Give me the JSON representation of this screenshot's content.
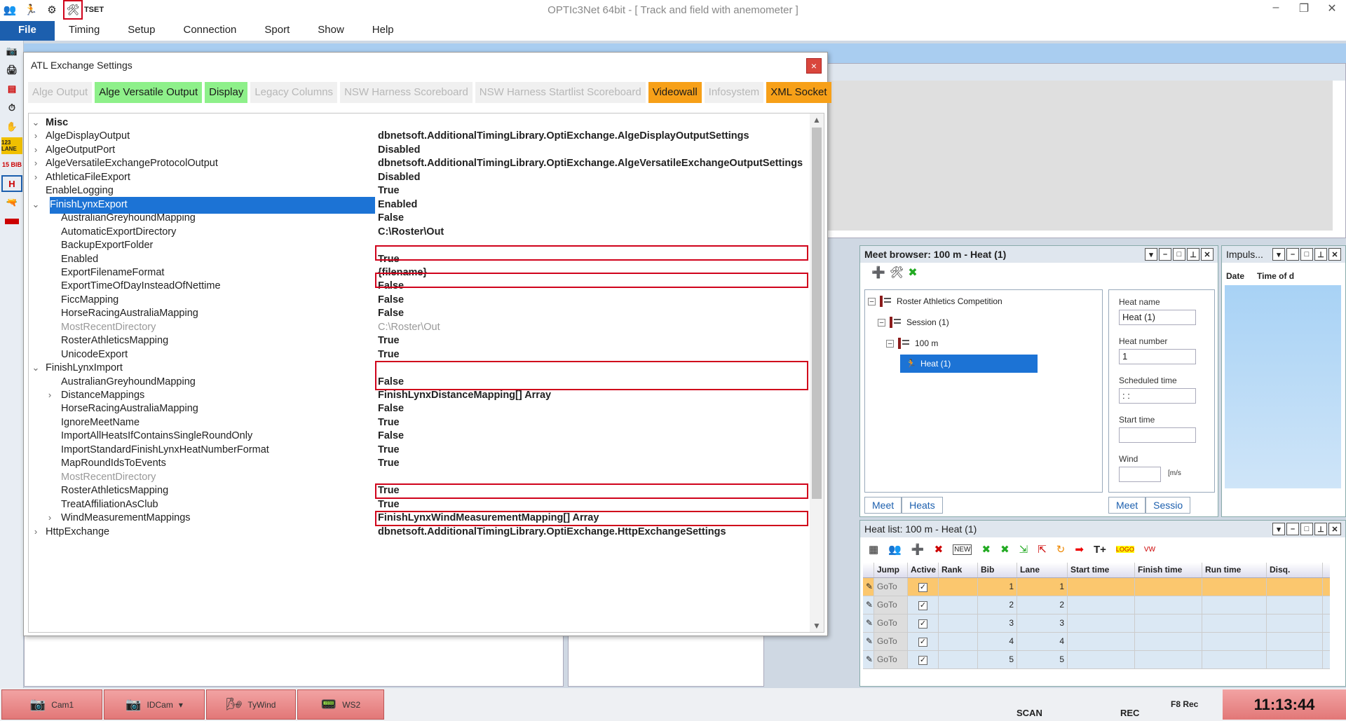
{
  "app": {
    "title": "OPTIc3Net 64bit - [ Track and field with anemometer ]",
    "quick_icons": [
      "users-icon",
      "runner-icon",
      "gear-icon",
      "tools-icon",
      "tset-icon"
    ],
    "tset_label": "TSET"
  },
  "menu": [
    "File",
    "Timing",
    "Setup",
    "Connection",
    "Sport",
    "Show",
    "Help"
  ],
  "left_toolbar": [
    "camera-icon",
    "printer-icon",
    "pdf-icon",
    "stopwatch-icon",
    "hand-icon",
    "lane-icon",
    "bib-icon",
    "h-icon",
    "gun-icon",
    "red-bar-icon"
  ],
  "left_toolbar_labels": {
    "lane": "123 LANE",
    "bib": "15 BIB",
    "h": "H"
  },
  "dialog": {
    "title": "ATL Exchange Settings",
    "close": "×",
    "tabs": [
      {
        "label": "Alge Output",
        "state": "disabled"
      },
      {
        "label": "Alge Versatile Output",
        "state": "green"
      },
      {
        "label": "Display",
        "state": "green"
      },
      {
        "label": "Legacy Columns",
        "state": "disabled"
      },
      {
        "label": "NSW Harness Scoreboard",
        "state": "disabled"
      },
      {
        "label": "NSW Harness Startlist Scoreboard",
        "state": "disabled"
      },
      {
        "label": "Videowall",
        "state": "orange"
      },
      {
        "label": "Infosystem",
        "state": "disabled"
      },
      {
        "label": "XML Socket",
        "state": "orange"
      }
    ],
    "rows": [
      {
        "name": "Misc",
        "value": "",
        "level": 0,
        "exp": "v",
        "kind": "cat"
      },
      {
        "name": "AlgeDisplayOutput",
        "value": "dbnetsoft.AdditionalTimingLibrary.OptiExchange.AlgeDisplayOutputSettings",
        "level": 1,
        "exp": ">"
      },
      {
        "name": "AlgeOutputPort",
        "value": "Disabled",
        "level": 1,
        "exp": ">"
      },
      {
        "name": "AlgeVersatileExchangeProtocolOutput",
        "value": "dbnetsoft.AdditionalTimingLibrary.OptiExchange.AlgeVersatileExchangeOutputSettings",
        "level": 1,
        "exp": ">"
      },
      {
        "name": "AthleticaFileExport",
        "value": "Disabled",
        "level": 1,
        "exp": ">"
      },
      {
        "name": "EnableLogging",
        "value": "True",
        "level": 1,
        "exp": ""
      },
      {
        "name": "FinishLynxExport",
        "value": "Enabled",
        "level": 1,
        "exp": "v",
        "kind": "selected"
      },
      {
        "name": "AustralianGreyhoundMapping",
        "value": "False",
        "level": 2,
        "exp": ""
      },
      {
        "name": "AutomaticExportDirectory",
        "value": "C:\\Roster\\Out",
        "level": 2,
        "exp": ""
      },
      {
        "name": "BackupExportFolder",
        "value": "",
        "level": 2,
        "exp": ""
      },
      {
        "name": "Enabled",
        "value": "True",
        "level": 2,
        "exp": ""
      },
      {
        "name": "ExportFilenameFormat",
        "value": "{filename}",
        "level": 2,
        "exp": ""
      },
      {
        "name": "ExportTimeOfDayInsteadOfNettime",
        "value": "False",
        "level": 2,
        "exp": ""
      },
      {
        "name": "FiccMapping",
        "value": "False",
        "level": 2,
        "exp": ""
      },
      {
        "name": "HorseRacingAustraliaMapping",
        "value": "False",
        "level": 2,
        "exp": ""
      },
      {
        "name": "MostRecentDirectory",
        "value": "C:\\Roster\\Out",
        "level": 2,
        "exp": "",
        "kind": "ro"
      },
      {
        "name": "RosterAthleticsMapping",
        "value": "True",
        "level": 2,
        "exp": ""
      },
      {
        "name": "UnicodeExport",
        "value": "True",
        "level": 2,
        "exp": ""
      },
      {
        "name": "FinishLynxImport",
        "value": "",
        "level": 1,
        "exp": "v"
      },
      {
        "name": "AustralianGreyhoundMapping",
        "value": "False",
        "level": 2,
        "exp": ""
      },
      {
        "name": "DistanceMappings",
        "value": "FinishLynxDistanceMapping[] Array",
        "level": 2,
        "exp": ">"
      },
      {
        "name": "HorseRacingAustraliaMapping",
        "value": "False",
        "level": 2,
        "exp": ""
      },
      {
        "name": "IgnoreMeetName",
        "value": "True",
        "level": 2,
        "exp": ""
      },
      {
        "name": "ImportAllHeatsIfContainsSingleRoundOnly",
        "value": "False",
        "level": 2,
        "exp": ""
      },
      {
        "name": "ImportStandardFinishLynxHeatNumberFormat",
        "value": "True",
        "level": 2,
        "exp": ""
      },
      {
        "name": "MapRoundIdsToEvents",
        "value": "True",
        "level": 2,
        "exp": ""
      },
      {
        "name": "MostRecentDirectory",
        "value": "",
        "level": 2,
        "exp": "",
        "kind": "ro"
      },
      {
        "name": "RosterAthleticsMapping",
        "value": "True",
        "level": 2,
        "exp": ""
      },
      {
        "name": "TreatAffiliationAsClub",
        "value": "True",
        "level": 2,
        "exp": ""
      },
      {
        "name": "WindMeasurementMappings",
        "value": "FinishLynxWindMeasurementMapping[] Array",
        "level": 2,
        "exp": ">"
      },
      {
        "name": "HttpExchange",
        "value": "dbnetsoft.AdditionalTimingLibrary.OptiExchange.HttpExchangeSettings",
        "level": 1,
        "exp": ">"
      }
    ]
  },
  "meet_browser": {
    "title": "Meet browser: 100 m - Heat (1)",
    "tree": [
      "Roster  Athletics Competition",
      "Session (1)",
      "100 m",
      "Heat (1)"
    ],
    "labels": {
      "heat_name": "Heat name",
      "heat_number": "Heat number",
      "scheduled": "Scheduled time",
      "start": "Start time",
      "wind": "Wind"
    },
    "values": {
      "heat_name": "Heat (1)",
      "heat_number": "1",
      "scheduled": " :  :",
      "wind_unit": "[m/s"
    },
    "tabs_left": [
      "Meet",
      "Heats"
    ],
    "tabs_right": [
      "Meet",
      "Sessio"
    ]
  },
  "impuls": {
    "title": "Impuls...",
    "cols": [
      "Date",
      "Time of d"
    ]
  },
  "heat_list": {
    "title": "Heat list: 100 m - Heat (1)",
    "new_label": "NEW",
    "logo_label": "LOGO",
    "vw_label": "VW",
    "columns": [
      "Jump",
      "Active",
      "Rank",
      "Bib",
      "Lane",
      "Start time",
      "Finish time",
      "Run time",
      "Disq.",
      "D"
    ],
    "rows": [
      {
        "jump": "GoTo",
        "active": "✓",
        "bib": "1",
        "lane": "1"
      },
      {
        "jump": "GoTo",
        "active": "✓",
        "bib": "2",
        "lane": "2"
      },
      {
        "jump": "GoTo",
        "active": "✓",
        "bib": "3",
        "lane": "3"
      },
      {
        "jump": "GoTo",
        "active": "✓",
        "bib": "4",
        "lane": "4"
      },
      {
        "jump": "GoTo",
        "active": "✓",
        "bib": "5",
        "lane": "5"
      }
    ]
  },
  "status": {
    "cam1": "Cam1",
    "idcam": "IDCam",
    "tywind": "TyWind",
    "ws2": "WS2",
    "scan": "SCAN",
    "rec": "REC",
    "f8rec": "F8 Rec",
    "clock": "11:13:44"
  },
  "colors": {
    "accent": "#1c5fae",
    "selection": "#1c73d5",
    "highlight_box": "#d0021b",
    "tab_green": "#8ef08a",
    "tab_orange": "#f7a018"
  }
}
